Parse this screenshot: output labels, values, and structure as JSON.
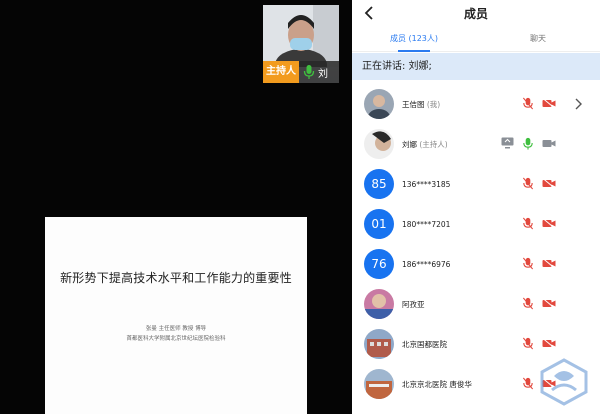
{
  "stage": {
    "slide_title": "新形势下提高技术水平和工作能力的重要性",
    "slide_author": "张曼  主任医师 教授 博导",
    "slide_affiliation": "首都医科大学附属北京世纪坛医院检验科",
    "host_tile": {
      "tag": "主持人",
      "name": "刘"
    }
  },
  "panel": {
    "title": "成员",
    "tabs": [
      {
        "label": "成员 (123人)",
        "active": true
      },
      {
        "label": "聊天",
        "active": false
      }
    ],
    "speaking": "正在讲话: 刘娜;",
    "members": [
      {
        "avatar": "photo",
        "avatar_text": "",
        "name": "王佶图",
        "sub": " (我)",
        "mic": "muted",
        "cam": "off",
        "chevron": true
      },
      {
        "avatar": "photo",
        "avatar_text": "",
        "name": "刘娜",
        "sub": " (主持人)",
        "mic": "active",
        "cam": "on",
        "share": true
      },
      {
        "avatar": "number",
        "avatar_text": "85",
        "name": "136****3185",
        "sub": "",
        "mic": "muted",
        "cam": "off"
      },
      {
        "avatar": "number",
        "avatar_text": "01",
        "name": "180****7201",
        "sub": "",
        "mic": "muted",
        "cam": "off"
      },
      {
        "avatar": "number",
        "avatar_text": "76",
        "name": "186****6976",
        "sub": "",
        "mic": "muted",
        "cam": "off"
      },
      {
        "avatar": "photo",
        "avatar_text": "",
        "name": "阿孜亚",
        "sub": "",
        "mic": "muted",
        "cam": "off"
      },
      {
        "avatar": "photo",
        "avatar_text": "",
        "name": "北京国都医院",
        "sub": "",
        "mic": "muted",
        "cam": "off"
      },
      {
        "avatar": "photo",
        "avatar_text": "",
        "name": "北京京北医院 唐俊华",
        "sub": "",
        "mic": "muted",
        "cam": "off"
      }
    ]
  },
  "colors": {
    "accent": "#2b7bf0",
    "host_tag": "#f29b1e",
    "mute_red": "#e2483d",
    "mic_green": "#3fbf3f"
  }
}
